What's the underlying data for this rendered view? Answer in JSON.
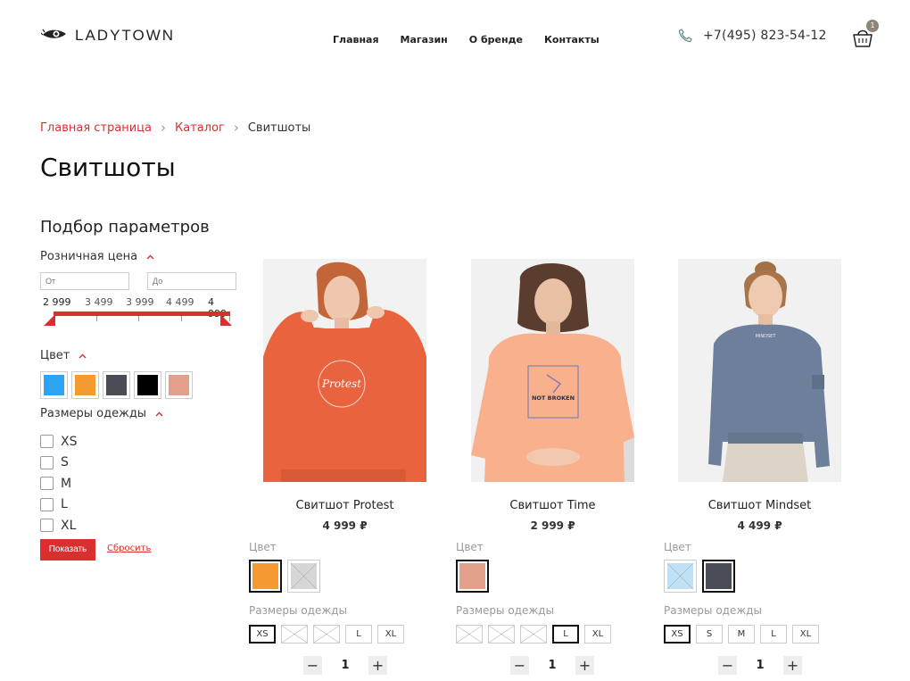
{
  "header": {
    "logo_text": "LADYTOWN",
    "nav": [
      "Главная",
      "Магазин",
      "О бренде",
      "Контакты"
    ],
    "phone": "+7(495) 823-54-12",
    "cart_count": "1"
  },
  "breadcrumb": {
    "items": [
      "Главная страница",
      "Каталог"
    ],
    "current": "Свитшоты"
  },
  "page_title": "Свитшоты",
  "filter": {
    "title": "Подбор параметров",
    "price_label": "Розничная цена",
    "from_placeholder": "От",
    "to_placeholder": "До",
    "ticks": [
      "2 999",
      "3 499",
      "3 999",
      "4 499",
      "4 999"
    ],
    "range_min": 2999,
    "range_max": 4999,
    "color_label": "Цвет",
    "colors": [
      "#2ea3f2",
      "#f49a30",
      "#4a4d55",
      "#000000",
      "#e2a08a"
    ],
    "sizes_label": "Размеры одежды",
    "sizes": [
      "XS",
      "S",
      "M",
      "L",
      "XL"
    ],
    "show_button": "Показать",
    "reset_link": "Сбросить"
  },
  "products": [
    {
      "name": "Свитшот Protest",
      "price": "4 999 ₽",
      "color_label": "Цвет",
      "colors": [
        {
          "hex": "#f49a30",
          "selected": true,
          "available": true
        },
        {
          "hex": "#d6d6d6",
          "selected": false,
          "available": false
        }
      ],
      "sizes_label": "Размеры одежды",
      "sizes": [
        {
          "label": "XS",
          "state": "selected"
        },
        {
          "label": "S",
          "state": "na"
        },
        {
          "label": "M",
          "state": "na"
        },
        {
          "label": "L",
          "state": "normal"
        },
        {
          "label": "XL",
          "state": "normal"
        }
      ],
      "qty": "1"
    },
    {
      "name": "Свитшот Time",
      "price": "2 999 ₽",
      "color_label": "Цвет",
      "colors": [
        {
          "hex": "#e2a08a",
          "selected": true,
          "available": true
        }
      ],
      "sizes_label": "Размеры одежды",
      "sizes": [
        {
          "label": "XS",
          "state": "na"
        },
        {
          "label": "S",
          "state": "na"
        },
        {
          "label": "M",
          "state": "na"
        },
        {
          "label": "L",
          "state": "selected"
        },
        {
          "label": "XL",
          "state": "normal"
        }
      ],
      "qty": "1"
    },
    {
      "name": "Свитшот Mindset",
      "price": "4 499 ₽",
      "color_label": "Цвет",
      "colors": [
        {
          "hex": "#bfe0f5",
          "selected": false,
          "available": false
        },
        {
          "hex": "#4a4d55",
          "selected": true,
          "available": true
        }
      ],
      "sizes_label": "Размеры одежды",
      "sizes": [
        {
          "label": "XS",
          "state": "selected"
        },
        {
          "label": "S",
          "state": "normal"
        },
        {
          "label": "M",
          "state": "normal"
        },
        {
          "label": "L",
          "state": "normal"
        },
        {
          "label": "XL",
          "state": "normal"
        }
      ],
      "qty": "1"
    }
  ],
  "colors": {
    "accent": "#d9302f",
    "text": "#222222",
    "muted": "#999999"
  }
}
